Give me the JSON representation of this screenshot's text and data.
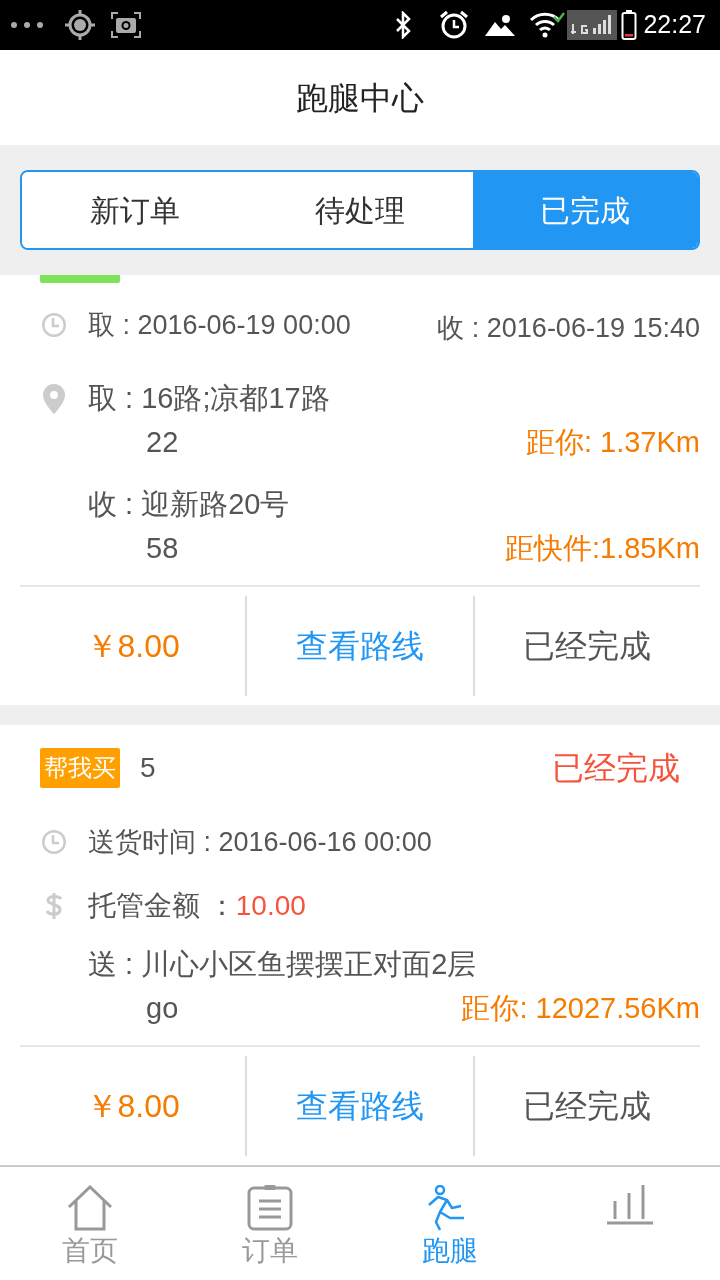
{
  "status_bar": {
    "time": "22:27"
  },
  "header": {
    "title": "跑腿中心"
  },
  "segments": [
    {
      "label": "新订单",
      "selected": false
    },
    {
      "label": "待处理",
      "selected": false
    },
    {
      "label": "已完成",
      "selected": true
    }
  ],
  "orders": [
    {
      "badge": {
        "color": "#7ee35a"
      },
      "rows": [
        {
          "kind": "times",
          "pickup": "取 : 2016-06-19 00:00",
          "receive": "收 : 2016-06-19 15:40"
        },
        {
          "kind": "pickup_address",
          "line1": "取 : 16路;凉都17路",
          "line2": "22",
          "distance": "距你: 1.37Km"
        },
        {
          "kind": "address",
          "line1": "收 : 迎新路20号",
          "line2": "58",
          "distance": "距快件:1.85Km"
        }
      ],
      "price": "￥8.00",
      "route_button": "查看路线",
      "status_button": "已经完成"
    },
    {
      "badge": {
        "color": "#ffa000",
        "label": "帮我买"
      },
      "number": "5",
      "status": "已经完成",
      "rows": [
        {
          "kind": "times",
          "pickup": "送货时间 : 2016-06-16 00:00"
        },
        {
          "kind": "amount",
          "label": "托管金额 ：",
          "value": "10.00"
        },
        {
          "kind": "address",
          "line1": "送 : 川心小区鱼摆摆正对面2层",
          "line2": "go",
          "distance": "距你: 12027.56Km"
        }
      ],
      "price": "￥8.00",
      "route_button": "查看路线",
      "status_button": "已经完成"
    }
  ],
  "nav": [
    {
      "label": "首页",
      "selected": false
    },
    {
      "label": "订单",
      "selected": false
    },
    {
      "label": "跑腿",
      "selected": true
    },
    {
      "selected": false
    }
  ]
}
